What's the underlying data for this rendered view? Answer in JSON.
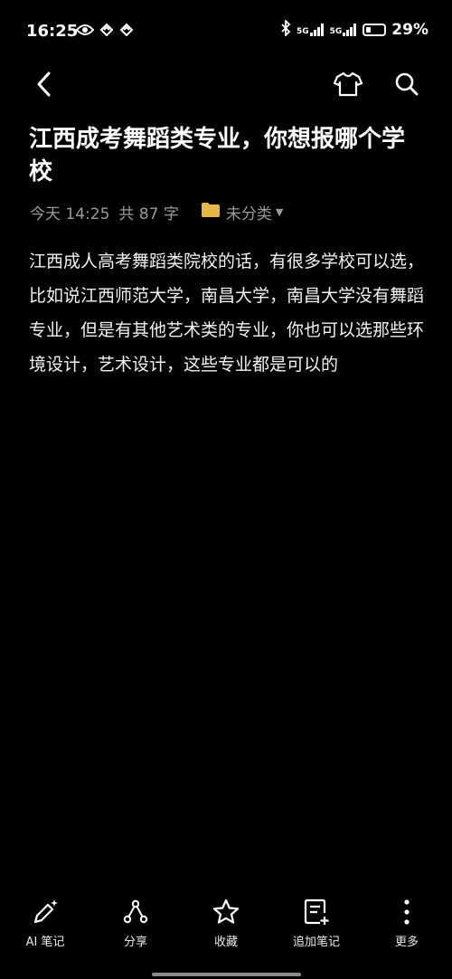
{
  "status_bar": {
    "time": "16:25",
    "network1": "5G",
    "network2": "5G",
    "battery_percent": 29,
    "battery_text": "29%"
  },
  "nav": {
    "back_icon": "chevron-left-icon",
    "theme_icon": "tshirt-icon",
    "search_icon": "search-icon"
  },
  "note": {
    "title": "江西成考舞蹈类专业，你想报哪个学校",
    "date": "今天 14:25",
    "word_count": "共 87 字",
    "category": "未分类",
    "body": "江西成人高考舞蹈类院校的话，有很多学校可以选，比如说江西师范大学，南昌大学，南昌大学没有舞蹈专业，但是有其他艺术类的专业，你也可以选那些环境设计，艺术设计，这些专业都是可以的"
  },
  "toolbar": {
    "ai_note": "AI 笔记",
    "share": "分享",
    "favorite": "收藏",
    "add_note": "追加笔记",
    "more": "更多"
  },
  "colors": {
    "background": "#000000",
    "folder": "#e6b84a",
    "meta_text": "#9a9a9a"
  }
}
